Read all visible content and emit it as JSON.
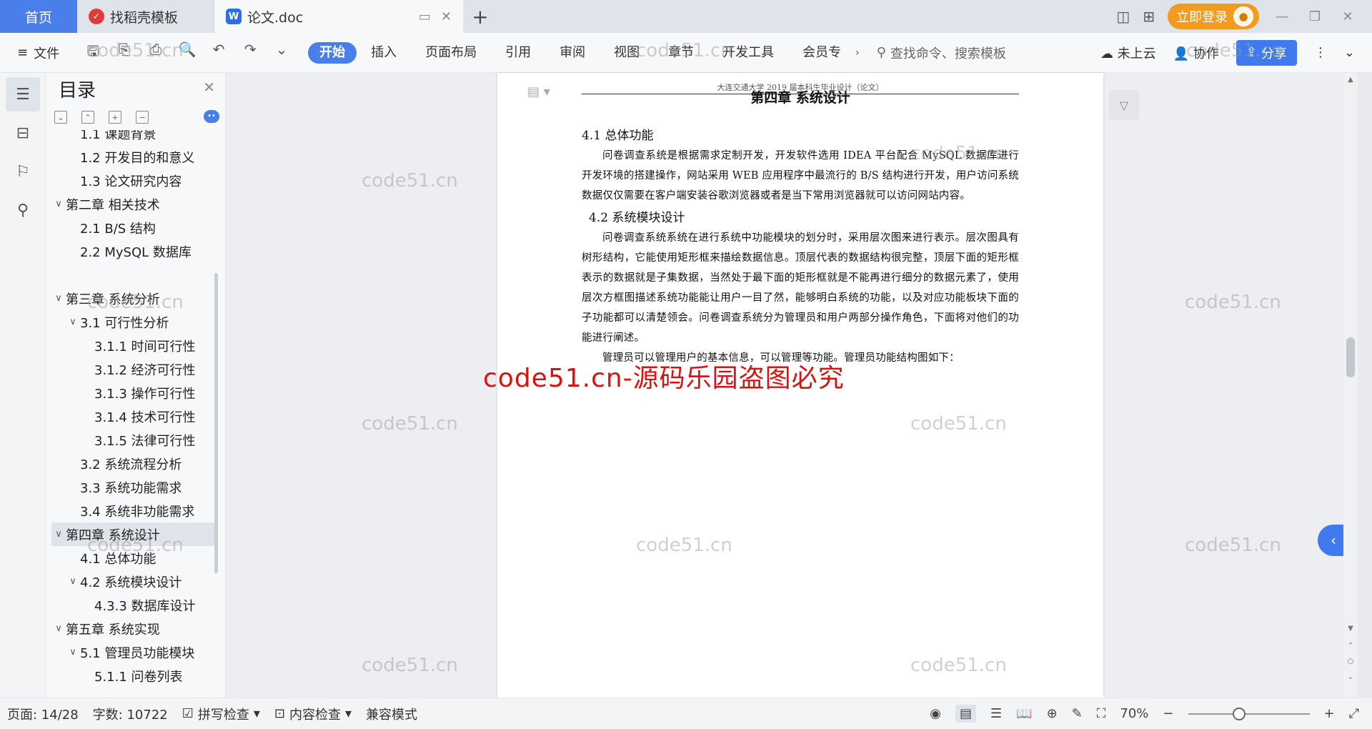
{
  "titlebar": {
    "home_tab": "首页",
    "tabs": [
      {
        "label": "找稻壳模板",
        "icon": "daoke-logo-icon"
      },
      {
        "label": "论文.doc",
        "icon": "wps-writer-icon"
      }
    ],
    "login_label": "立即登录"
  },
  "ribbon": {
    "file_label": "文件",
    "tabs": [
      "开始",
      "插入",
      "页面布局",
      "引用",
      "审阅",
      "视图",
      "章节",
      "开发工具",
      "会员专"
    ],
    "active_tab": "开始",
    "search_placeholder": "查找命令、搜索模板",
    "cloud_label": "未上云",
    "collab_label": "协作",
    "share_label": "分享"
  },
  "toc": {
    "title": "目录",
    "items": [
      {
        "label": "1.1 课题背景",
        "level": 2,
        "caret": ""
      },
      {
        "label": "1.2 开发目的和意义",
        "level": 2,
        "caret": ""
      },
      {
        "label": "1.3 论文研究内容",
        "level": 2,
        "caret": ""
      },
      {
        "label": "第二章 相关技术",
        "level": 1,
        "caret": "∨"
      },
      {
        "label": "2.1 B/S 结构",
        "level": 2,
        "caret": ""
      },
      {
        "label": "2.2 MySQL 数据库",
        "level": 2,
        "caret": ""
      },
      {
        "label": "",
        "level": 0,
        "caret": ""
      },
      {
        "label": "第三章 系统分析",
        "level": 1,
        "caret": "∨"
      },
      {
        "label": "3.1 可行性分析",
        "level": 2,
        "caret": "∨"
      },
      {
        "label": "3.1.1 时间可行性",
        "level": 3,
        "caret": ""
      },
      {
        "label": "3.1.2 经济可行性",
        "level": 3,
        "caret": ""
      },
      {
        "label": "3.1.3 操作可行性",
        "level": 3,
        "caret": ""
      },
      {
        "label": "3.1.4 技术可行性",
        "level": 3,
        "caret": ""
      },
      {
        "label": "3.1.5 法律可行性",
        "level": 3,
        "caret": ""
      },
      {
        "label": "3.2 系统流程分析",
        "level": 2,
        "caret": ""
      },
      {
        "label": "3.3 系统功能需求",
        "level": 2,
        "caret": ""
      },
      {
        "label": "3.4 系统非功能需求",
        "level": 2,
        "caret": ""
      },
      {
        "label": "第四章 系统设计",
        "level": 1,
        "caret": "∨",
        "selected": true
      },
      {
        "label": "4.1 总体功能",
        "level": 2,
        "caret": ""
      },
      {
        "label": "4.2 系统模块设计",
        "level": 2,
        "caret": "∨"
      },
      {
        "label": "4.3.3 数据库设计",
        "level": 3,
        "caret": ""
      },
      {
        "label": "第五章 系统实现",
        "level": 1,
        "caret": "∨"
      },
      {
        "label": "5.1 管理员功能模块",
        "level": 2,
        "caret": "∨"
      },
      {
        "label": "5.1.1 问卷列表",
        "level": 3,
        "caret": ""
      }
    ]
  },
  "document": {
    "running_header": "大连交通大学 2019 届本科生毕业设计（论文）",
    "chapter_title": "第四章  系统设计",
    "sections": [
      {
        "heading": "4.1  总体功能",
        "paragraphs": [
          "问卷调查系统是根据需求定制开发，开发软件选用 IDEA 平台配合 MySQL 数据库进行开发环境的搭建操作，网站采用 WEB 应用程序中最流行的 B/S 结构进行开发，用户访问系统数据仅仅需要在客户端安装谷歌浏览器或者是当下常用浏览器就可以访问网站内容。"
        ]
      },
      {
        "heading": "4.2  系统模块设计",
        "paragraphs": [
          "问卷调查系统系统在进行系统中功能模块的划分时，采用层次图来进行表示。层次图具有树形结构，它能使用矩形框来描绘数据信息。顶层代表的数据结构很完整，顶层下面的矩形框表示的数据就是子集数据，当然处于最下面的矩形框就是不能再进行细分的数据元素了，使用层次方框图描述系统功能能让用户一目了然，能够明白系统的功能，以及对应功能板块下面的子功能都可以清楚领会。问卷调查系统分为管理员和用户两部分操作角色，下面将对他们的功能进行阐述。",
          "管理员可以管理用户的基本信息，可以管理等功能。管理员功能结构图如下："
        ]
      }
    ]
  },
  "watermark": {
    "text": "code51.cn",
    "red_text": "code51.cn-源码乐园盗图必究"
  },
  "statusbar": {
    "page": "页面: 14/28",
    "words": "字数: 10722",
    "spell_check": "拼写检查",
    "content_check": "内容检查",
    "compat_mode": "兼容模式",
    "zoom": "70%"
  }
}
